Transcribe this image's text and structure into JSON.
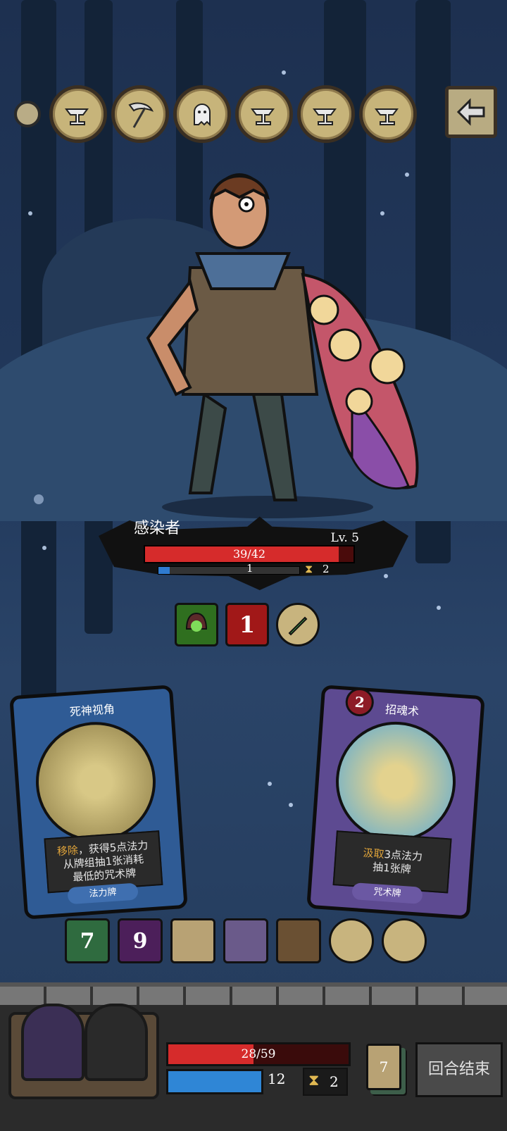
{
  "top": {
    "rewards": [
      "anvil-icon",
      "scythe-icon",
      "ghost-icon",
      "anvil-icon",
      "anvil-icon",
      "anvil-icon"
    ],
    "back_icon": "back-arrow-icon"
  },
  "enemy": {
    "name": "感染者",
    "level": "Lv. 5",
    "hp_text": "39/42",
    "hp": 39,
    "hp_max": 42,
    "shield": "1",
    "timer": "2",
    "intents": {
      "poison": "",
      "attack": "1",
      "weapon": ""
    }
  },
  "cards": {
    "left": {
      "title": "死神视角",
      "desc_hl": "移除",
      "desc_line1_rest": "，获得5点法力",
      "desc_line2": "从牌组抽1张消耗",
      "desc_line3": "最低的咒术牌",
      "type": "法力牌"
    },
    "right": {
      "cost": "2",
      "title": "招魂术",
      "desc_hl": "汲取",
      "desc_line1_rest": "3点法力",
      "desc_line2": "抽1张牌",
      "type": "咒术牌"
    }
  },
  "pile": {
    "c1": "7",
    "c2": "9"
  },
  "player": {
    "hp_text": "28/59",
    "hp": 28,
    "hp_max": 59,
    "mana": "12",
    "timer": "2",
    "deck_count": "7",
    "end_turn": "回合结束"
  }
}
